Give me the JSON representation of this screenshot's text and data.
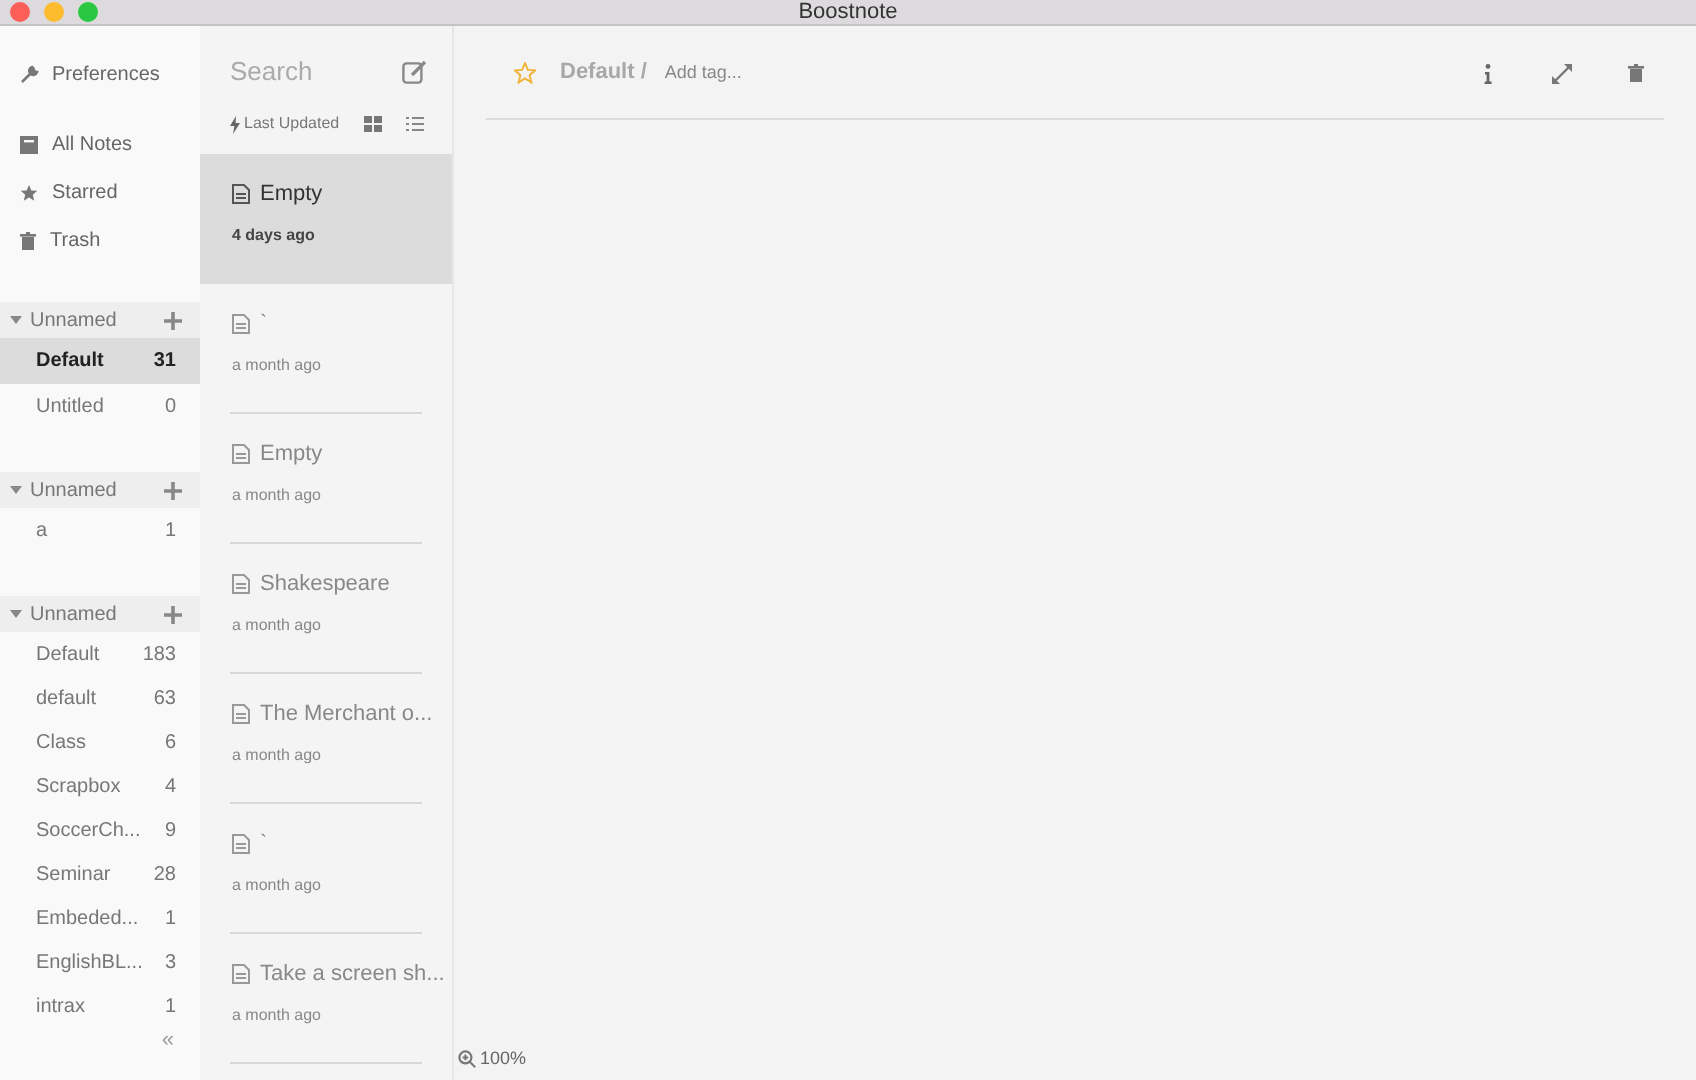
{
  "window": {
    "title": "Boostnote"
  },
  "sidebar": {
    "preferences": "Preferences",
    "nav": [
      {
        "label": "All Notes"
      },
      {
        "label": "Starred"
      },
      {
        "label": "Trash"
      }
    ],
    "storages": [
      {
        "name": "Unnamed",
        "folders": [
          {
            "name": "Default",
            "count": "31",
            "selected": true
          },
          {
            "name": "Untitled",
            "count": "0",
            "selected": false
          }
        ]
      },
      {
        "name": "Unnamed",
        "folders": [
          {
            "name": "a",
            "count": "1",
            "selected": false
          }
        ]
      },
      {
        "name": "Unnamed",
        "folders": [
          {
            "name": "Default",
            "count": "183",
            "selected": false
          },
          {
            "name": "default",
            "count": "63",
            "selected": false
          },
          {
            "name": "Class",
            "count": "6",
            "selected": false
          },
          {
            "name": "Scrapbox",
            "count": "4",
            "selected": false
          },
          {
            "name": "SoccerCh...",
            "count": "9",
            "selected": false
          },
          {
            "name": "Seminar",
            "count": "28",
            "selected": false
          },
          {
            "name": "Embeded...",
            "count": "1",
            "selected": false
          },
          {
            "name": "EnglishBL...",
            "count": "3",
            "selected": false
          },
          {
            "name": "intrax",
            "count": "1",
            "selected": false
          }
        ]
      }
    ],
    "collapse": "«"
  },
  "note_list": {
    "search": "Search",
    "sort": "Last Updated",
    "notes": [
      {
        "title": "Empty",
        "date": "4 days ago",
        "selected": true
      },
      {
        "title": "`",
        "date": "a month ago",
        "selected": false
      },
      {
        "title": "Empty",
        "date": "a month ago",
        "selected": false
      },
      {
        "title": "Shakespeare",
        "date": "a month ago",
        "selected": false
      },
      {
        "title": "The Merchant o...",
        "date": "a month ago",
        "selected": false
      },
      {
        "title": "`",
        "date": "a month ago",
        "selected": false
      },
      {
        "title": "Take a screen sh...",
        "date": "a month ago",
        "selected": false
      }
    ]
  },
  "editor": {
    "starred": false,
    "folder": "Default /",
    "tag_placeholder": "Add tag...",
    "zoom": "100%"
  }
}
